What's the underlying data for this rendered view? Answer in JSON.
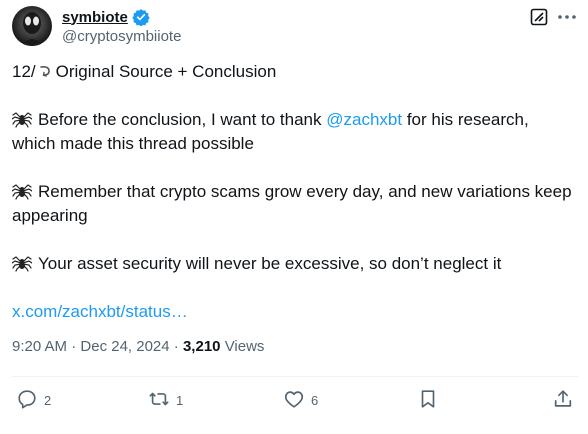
{
  "author": {
    "display_name": "symbiote",
    "handle": "@cryptosymbiiote",
    "verified": true
  },
  "tweet": {
    "line1_prefix": "12/",
    "line1_text": "Original Source + Conclusion",
    "para1_text": "Before the conclusion, I want to thank ",
    "para1_mention": "@zachxbt",
    "para1_suffix": " for his research, which made this thread possible",
    "para2_text": "Remember that crypto scams grow every day, and new variations keep appearing",
    "para3_text": "Your asset security will never be excessive, so don’t neglect it",
    "link_text": "x.com/zachxbt/status…"
  },
  "meta": {
    "time": "9:20 AM",
    "date": "Dec 24, 2024",
    "separator": "·",
    "views_count": "3,210",
    "views_label": "Views"
  },
  "actions": {
    "replies": "2",
    "reposts": "1",
    "likes": "6"
  },
  "icons": [
    "avatar",
    "verified-icon",
    "grok-icon",
    "more-icon",
    "spider-icon",
    "hook-icon",
    "reply-icon",
    "repost-icon",
    "like-icon",
    "bookmark-icon",
    "share-icon"
  ],
  "colors": {
    "accent": "#1d9bf0",
    "text": "#0f1419",
    "muted": "#536471"
  }
}
